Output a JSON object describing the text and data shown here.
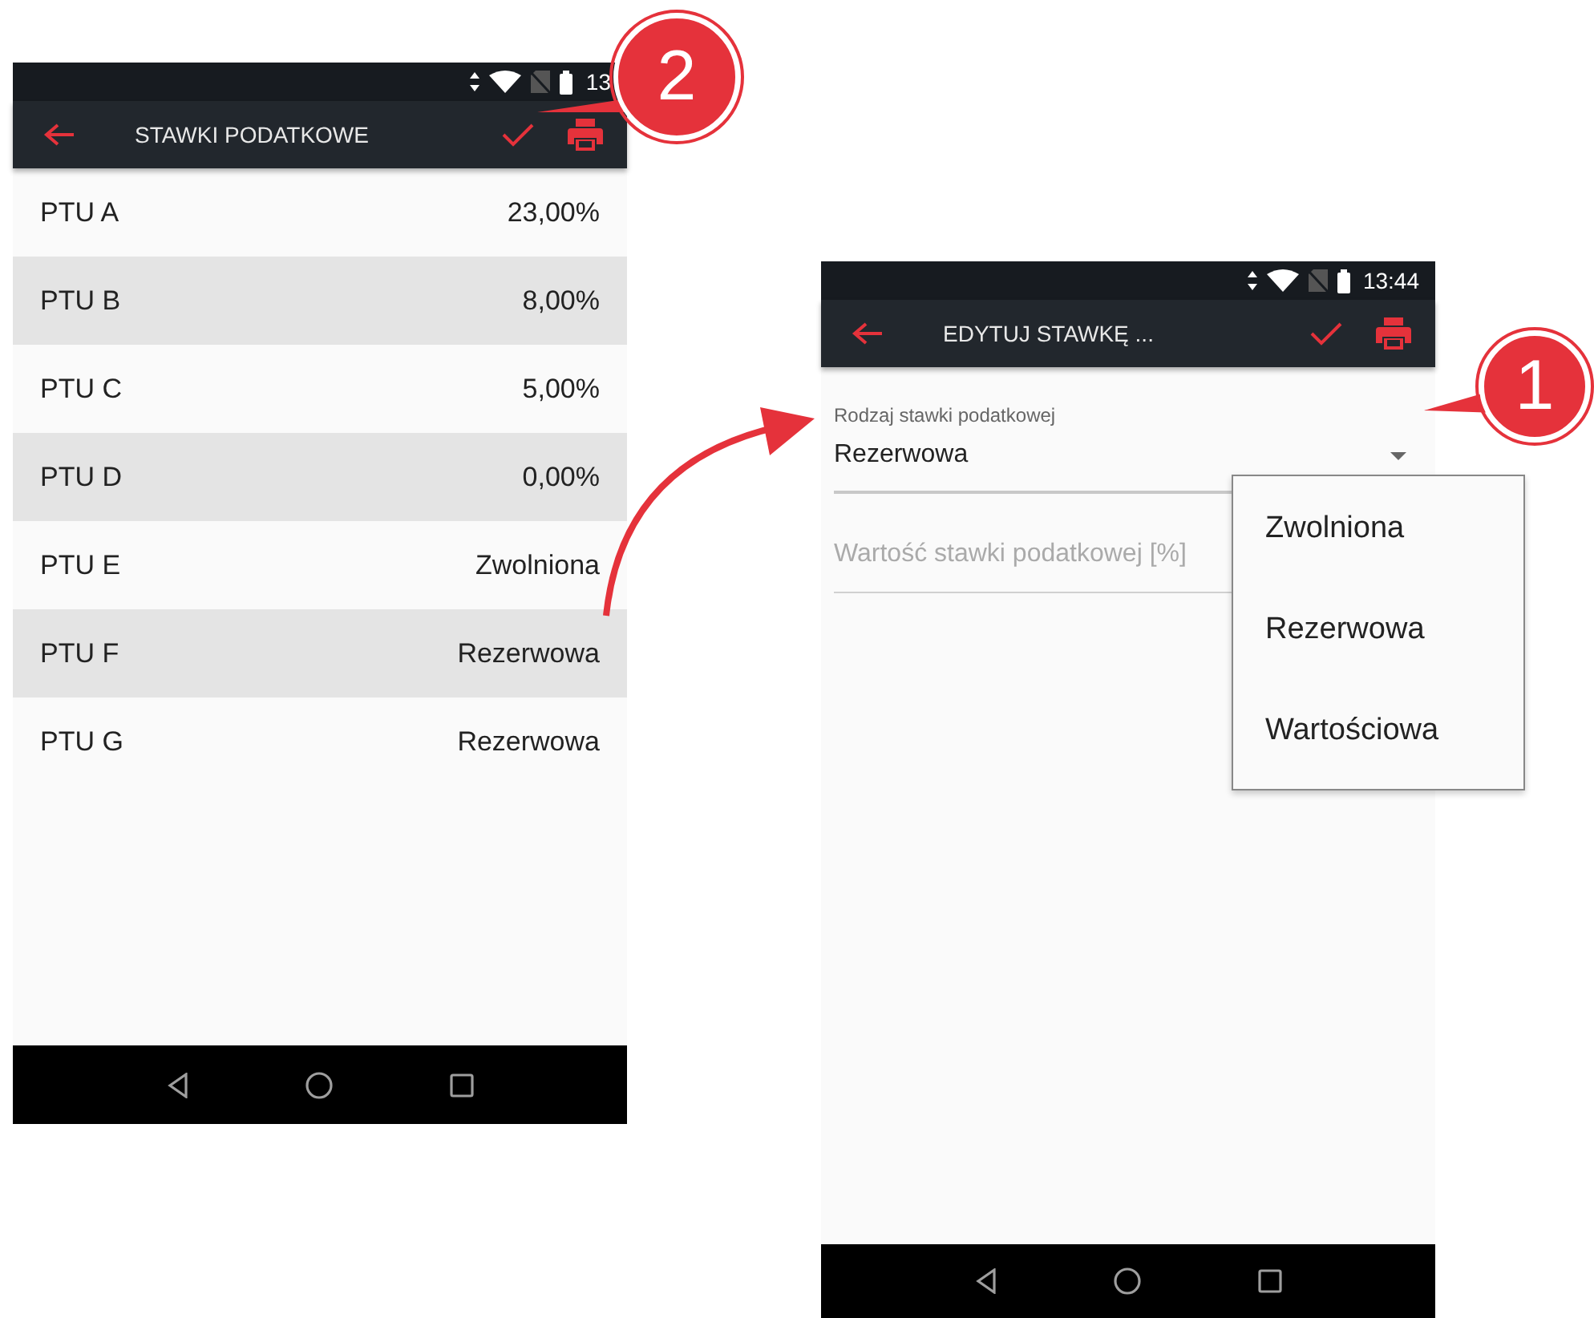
{
  "left_screen": {
    "status_bar": {
      "time": "13"
    },
    "toolbar": {
      "title": "STAWKI PODATKOWE"
    },
    "rows": [
      {
        "name": "PTU A",
        "value": "23,00%"
      },
      {
        "name": "PTU B",
        "value": "8,00%"
      },
      {
        "name": "PTU C",
        "value": "5,00%"
      },
      {
        "name": "PTU D",
        "value": "0,00%"
      },
      {
        "name": "PTU E",
        "value": "Zwolniona"
      },
      {
        "name": "PTU F",
        "value": "Rezerwowa"
      },
      {
        "name": "PTU G",
        "value": "Rezerwowa"
      }
    ]
  },
  "right_screen": {
    "status_bar": {
      "time": "13:44"
    },
    "toolbar": {
      "title": "EDYTUJ STAWKĘ ..."
    },
    "type_field": {
      "label": "Rodzaj stawki podatkowej",
      "value": "Rezerwowa"
    },
    "rate_field": {
      "placeholder": "Wartość stawki podatkowej [%]"
    },
    "dropdown_options": [
      "Zwolniona",
      "Rezerwowa",
      "Wartościowa"
    ]
  },
  "callouts": [
    "1",
    "2"
  ]
}
